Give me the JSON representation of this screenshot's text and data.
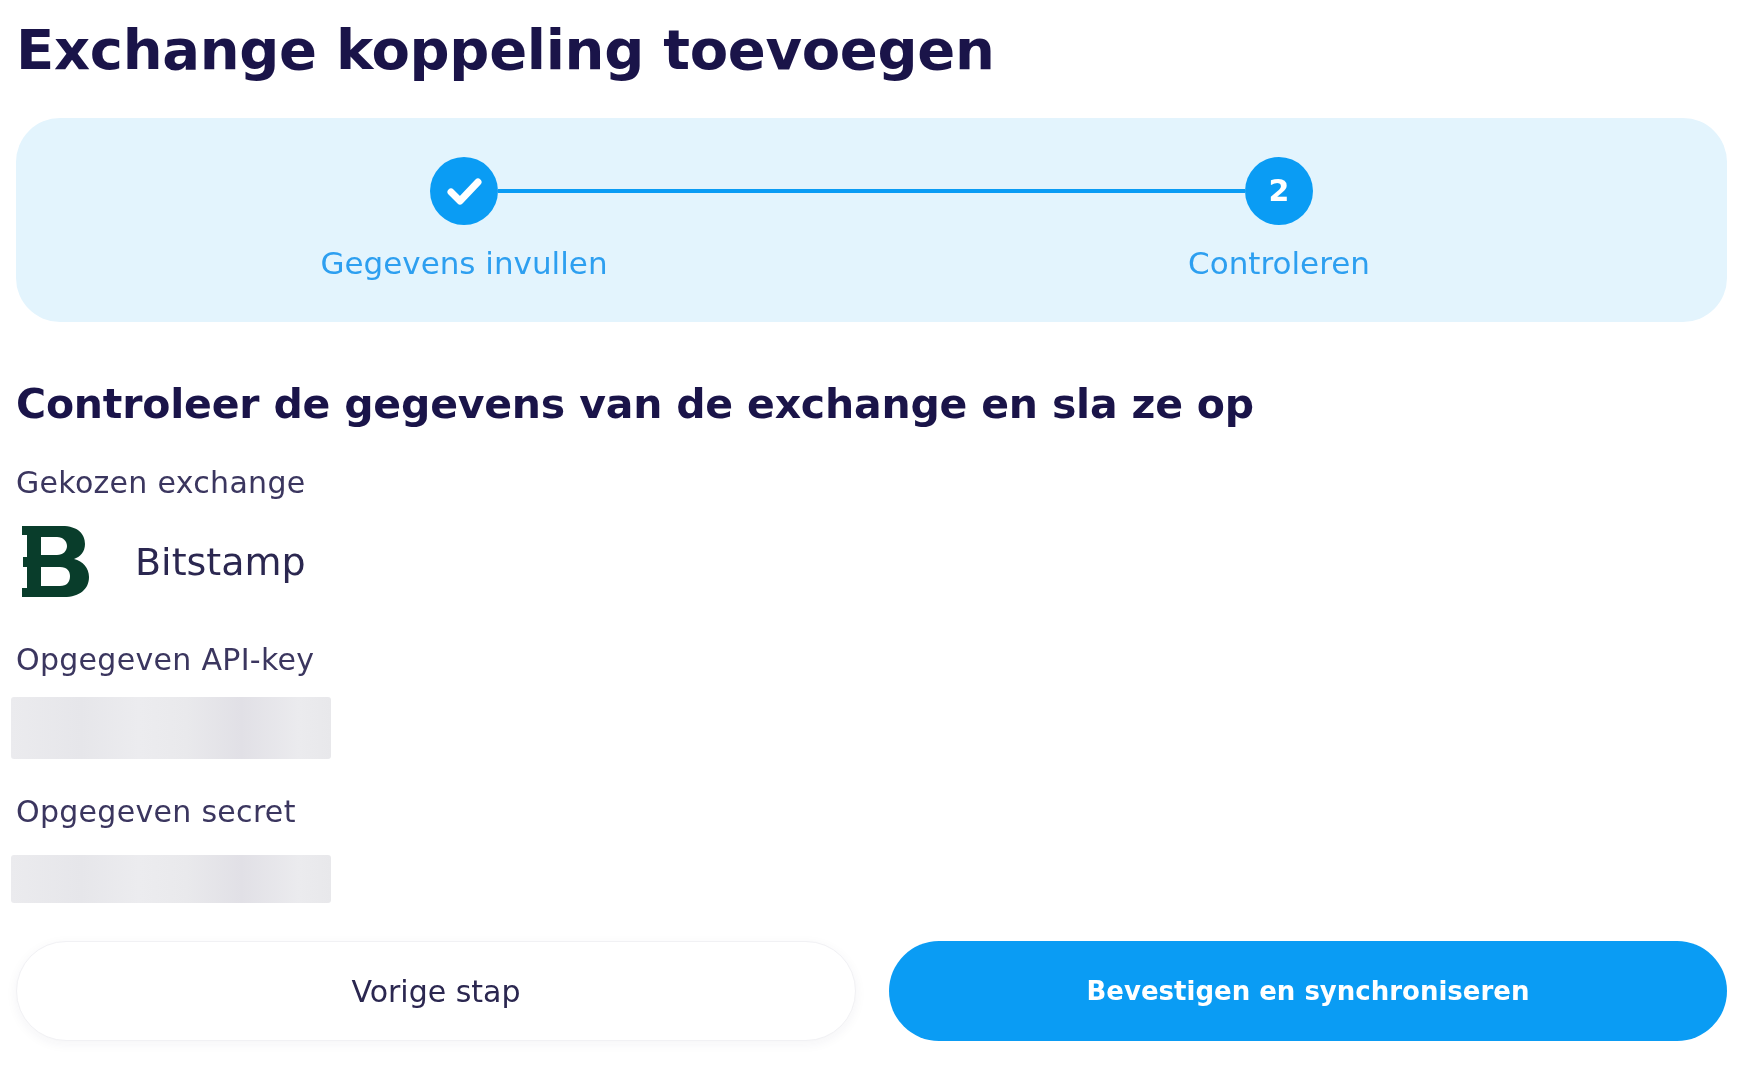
{
  "title": "Exchange koppeling toevoegen",
  "stepper": {
    "steps": [
      {
        "label": "Gegevens invullen",
        "completed": true
      },
      {
        "number": "2",
        "label": "Controleren",
        "completed": false
      }
    ]
  },
  "heading": "Controleer de gegevens van de exchange en sla ze op",
  "fields": [
    {
      "kind": "exchange",
      "label": "Gekozen exchange",
      "value": "Bitstamp"
    },
    {
      "kind": "redacted",
      "label": "Opgegeven API-key"
    },
    {
      "kind": "redacted",
      "label": "Opgegeven secret"
    }
  ],
  "buttons": [
    {
      "kind": "secondary",
      "label": "Vorige stap"
    },
    {
      "kind": "primary",
      "label": "Bevestigen en synchroniseren"
    }
  ]
}
